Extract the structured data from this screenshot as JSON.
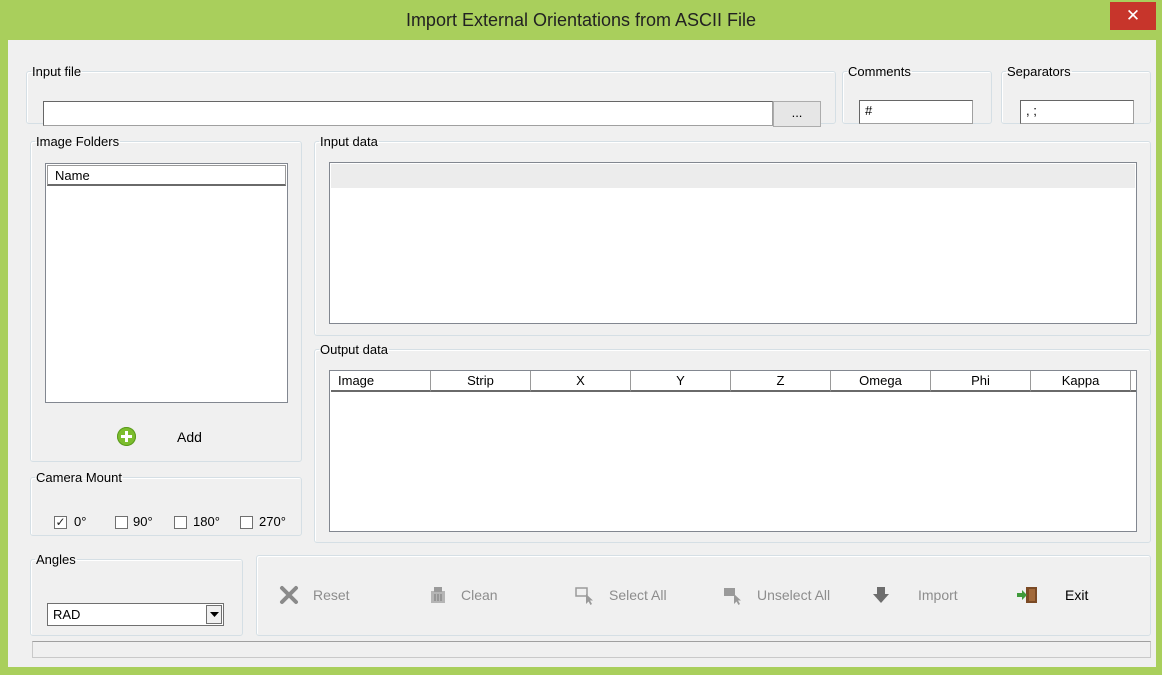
{
  "window": {
    "title": "Import External Orientations from ASCII File",
    "close_glyph": "✕"
  },
  "input_file": {
    "legend": "Input file",
    "value": "",
    "browse_label": "..."
  },
  "comments": {
    "legend": "Comments",
    "value": "#"
  },
  "separators": {
    "legend": "Separators",
    "value": ", ;"
  },
  "image_folders": {
    "legend": "Image Folders",
    "column_name": "Name",
    "add_label": "Add"
  },
  "input_data": {
    "legend": "Input data"
  },
  "output_data": {
    "legend": "Output data",
    "columns": [
      "Image",
      "Strip",
      "X",
      "Y",
      "Z",
      "Omega",
      "Phi",
      "Kappa"
    ]
  },
  "camera_mount": {
    "legend": "Camera Mount",
    "options": [
      {
        "label": "0°",
        "checked": true
      },
      {
        "label": "90°",
        "checked": false
      },
      {
        "label": "180°",
        "checked": false
      },
      {
        "label": "270°",
        "checked": false
      }
    ],
    "check_glyph": "✓"
  },
  "angles": {
    "legend": "Angles",
    "selected": "RAD"
  },
  "toolbar": {
    "reset": "Reset",
    "clean": "Clean",
    "select_all": "Select All",
    "unselect_all": "Unselect All",
    "import": "Import",
    "exit": "Exit"
  },
  "colors": {
    "title_bar": "#a9cf5c",
    "close": "#c7352b",
    "add_icon": "#7cbd2d",
    "exit_icon": "#3f9a3a"
  }
}
